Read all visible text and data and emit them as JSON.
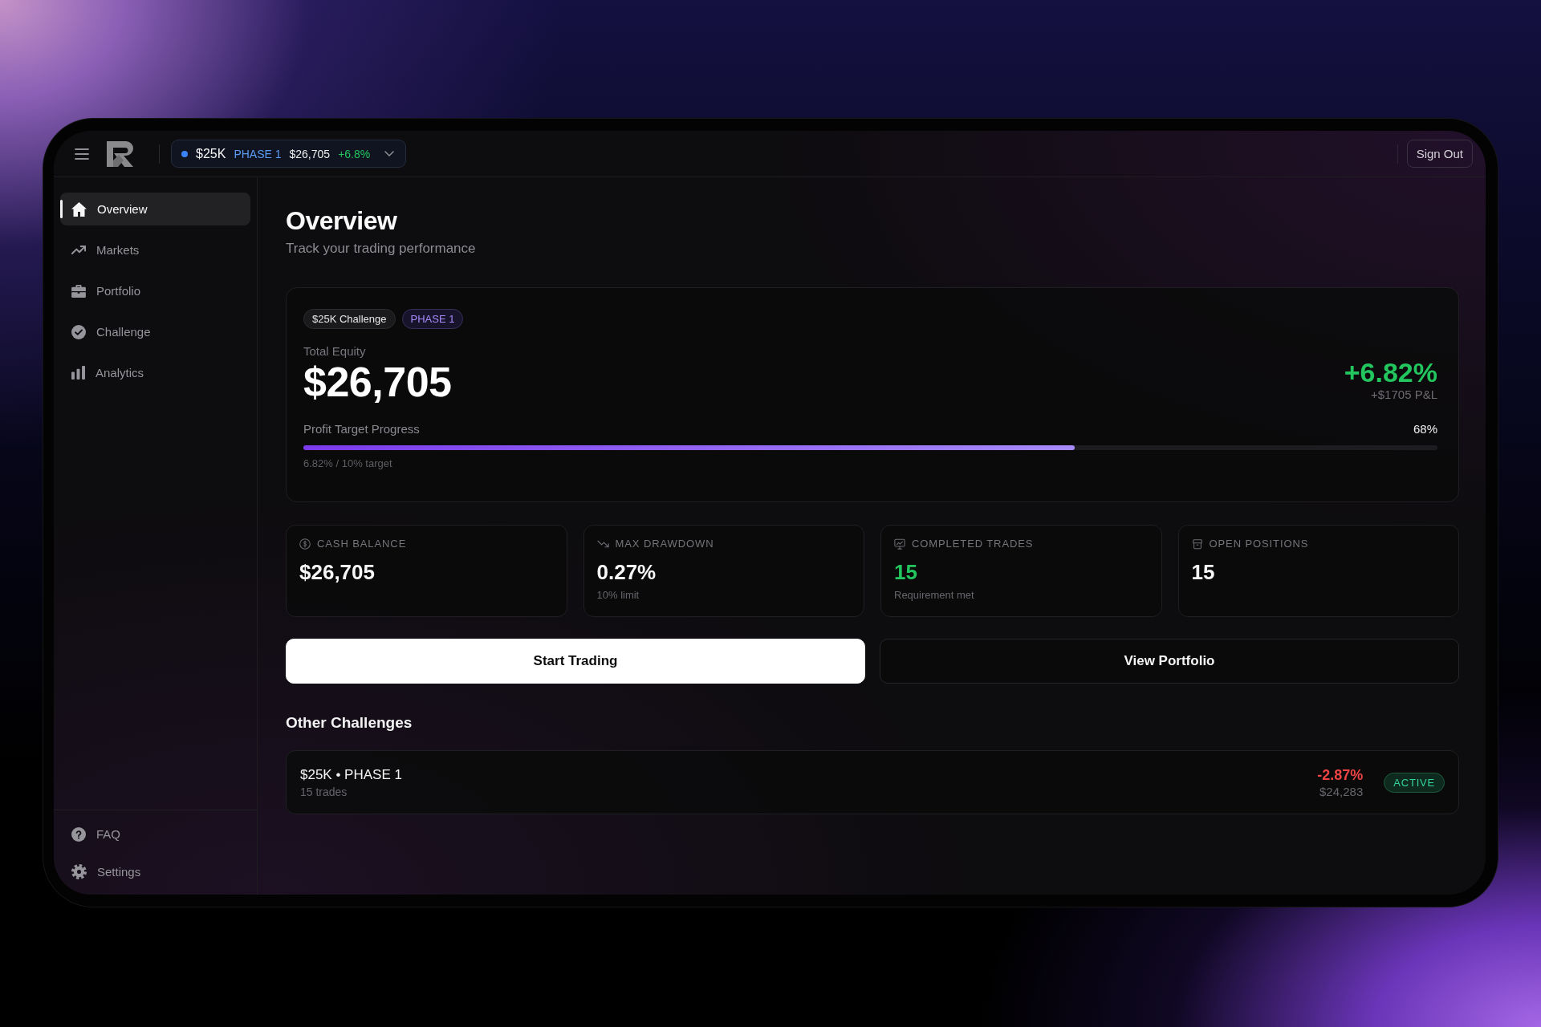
{
  "header": {
    "account": {
      "size": "$25K",
      "phase": "PHASE 1",
      "balance": "$26,705",
      "change": "+6.8%",
      "color": "#3b82f6"
    },
    "sign_out": "Sign Out"
  },
  "sidebar": {
    "items": [
      {
        "label": "Overview",
        "selected": true
      },
      {
        "label": "Markets",
        "selected": false
      },
      {
        "label": "Portfolio",
        "selected": false
      },
      {
        "label": "Challenge",
        "selected": false
      },
      {
        "label": "Analytics",
        "selected": false
      }
    ],
    "footer_items": [
      {
        "label": "FAQ",
        "selected": false
      },
      {
        "label": "Settings",
        "selected": false
      }
    ]
  },
  "page": {
    "title": "Overview",
    "subtitle": "Track your trading performance"
  },
  "equity_card": {
    "tags": [
      {
        "label": "$25K Challenge",
        "kind": "plain"
      },
      {
        "label": "PHASE 1",
        "kind": "phase"
      }
    ],
    "label": "Total Equity",
    "value": "$26,705",
    "change": "+6.82%",
    "pnl": "+$1705 P&L",
    "progress": {
      "label": "Profit Target Progress",
      "reading": "68%",
      "level": 0.68,
      "caption": "6.82% / 10% target"
    }
  },
  "stats": [
    {
      "label": "CASH BALANCE",
      "value": "$26,705",
      "highlighted": false
    },
    {
      "label": "MAX DRAWDOWN",
      "value": "0.27%",
      "note": "10% limit",
      "highlighted": false
    },
    {
      "label": "COMPLETED TRADES",
      "value": "15",
      "note": "Requirement met",
      "highlighted": true
    },
    {
      "label": "OPEN POSITIONS",
      "value": "15",
      "highlighted": false
    }
  ],
  "actions": [
    {
      "label": "Start Trading",
      "kind": "primary"
    },
    {
      "label": "View Portfolio",
      "kind": "secondary"
    }
  ],
  "other_challenges": {
    "title": "Other Challenges",
    "items": [
      {
        "name": "$25K • PHASE 1",
        "trades": "15 trades",
        "change": "-2.87%",
        "balance": "$24,283",
        "status": "ACTIVE"
      }
    ]
  }
}
